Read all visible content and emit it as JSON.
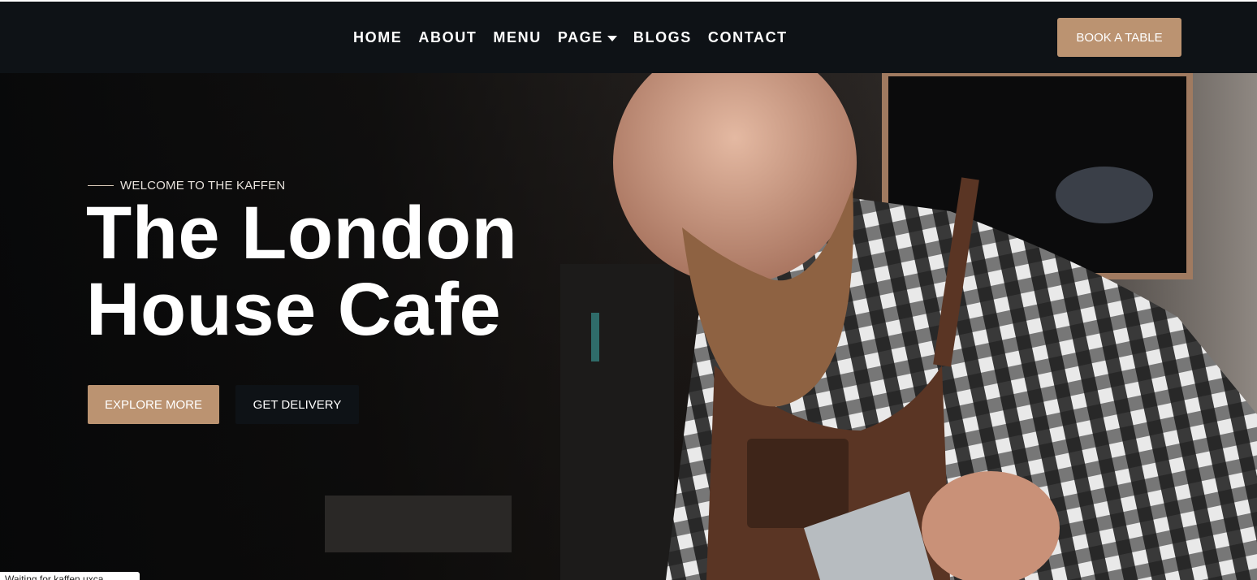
{
  "nav": {
    "links": [
      "HOME",
      "ABOUT",
      "MENU",
      "PAGE",
      "BLOGS",
      "CONTACT"
    ],
    "book_label": "BOOK A TABLE"
  },
  "hero": {
    "eyebrow": "WELCOME TO THE KAFFEN",
    "title_line1": "The London",
    "title_line2": "House Cafe",
    "explore_label": "EXPLORE MORE",
    "delivery_label": "GET DELIVERY"
  },
  "status": "Waiting for kaffen.uxca...",
  "colors": {
    "accent": "#bb9371",
    "dark": "#0e1216"
  },
  "icons": {
    "page_dropdown": "chevron-down-icon"
  }
}
